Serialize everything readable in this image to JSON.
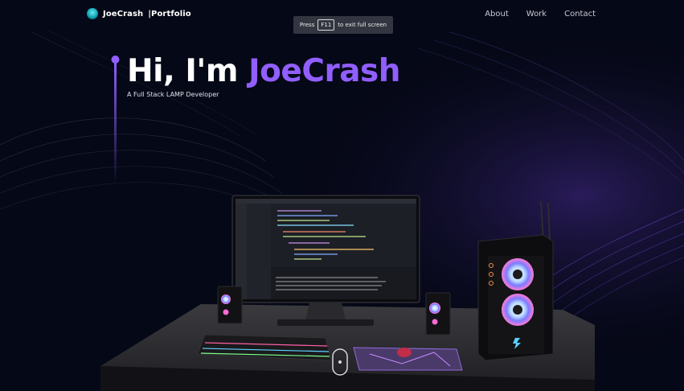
{
  "nav": {
    "brand_name": "JoeCrash",
    "brand_suffix": "|Portfolio",
    "links": [
      "About",
      "Work",
      "Contact"
    ]
  },
  "fullscreen_hint": {
    "prefix": "Press",
    "key": "F11",
    "suffix": "to exit full screen"
  },
  "hero": {
    "greeting": "Hi, I'm",
    "name": "JoeCrash",
    "subtitle": "A Full Stack LAMP Developer"
  },
  "colors": {
    "background": "#050816",
    "accent": "#915eff",
    "desk": "#2a2a2e"
  },
  "scene_icons": [
    "monitor-icon",
    "keyboard-icon",
    "mouse-icon",
    "speaker-icon",
    "pc-tower-icon"
  ]
}
